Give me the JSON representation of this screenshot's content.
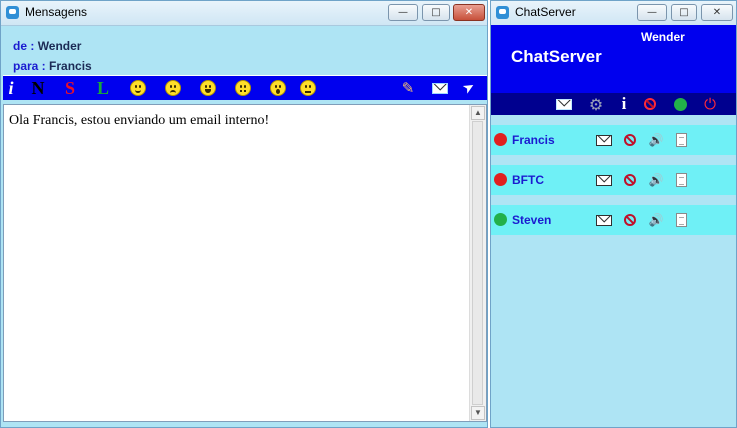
{
  "mensagens_window": {
    "title": "Mensagens",
    "controls": {
      "minimize": "—",
      "maximize": "□",
      "close": "✕"
    },
    "from_label": "de :",
    "from_value": "Wender",
    "to_label": "para :",
    "to_value": "Francis",
    "toolbar": {
      "italic": "i",
      "normal": "N",
      "strike": "S",
      "link": "L",
      "emoticons": [
        "smile-icon",
        "sad-icon",
        "grin-icon",
        "confused-icon",
        "surprised-icon",
        "neutral-icon"
      ],
      "pen_icon": "✎",
      "mail_icon": "envelope-icon",
      "send_icon": "➤"
    },
    "message_text": "Ola Francis, estou enviando um email interno!",
    "scroll": {
      "up": "▲",
      "down": "▼"
    }
  },
  "chatserver_window": {
    "title": "ChatServer",
    "controls": {
      "minimize": "—",
      "maximize": "□",
      "close": "✕"
    },
    "username": "Wender",
    "brand": "ChatServer",
    "toolbar": {
      "info_icon": "i",
      "settings_icon": "⚙",
      "power_icon": "⏻"
    },
    "contacts": [
      {
        "name": "Francis",
        "status_color": "#e02020"
      },
      {
        "name": "BFTC",
        "status_color": "#e02020"
      },
      {
        "name": "Steven",
        "status_color": "#22b04a"
      }
    ],
    "contact_speaker_icon": "🔊"
  },
  "colors": {
    "accent_blue": "#0000ee",
    "panel_cyan": "#aee4f4",
    "contact_row": "#6ff0f6"
  }
}
